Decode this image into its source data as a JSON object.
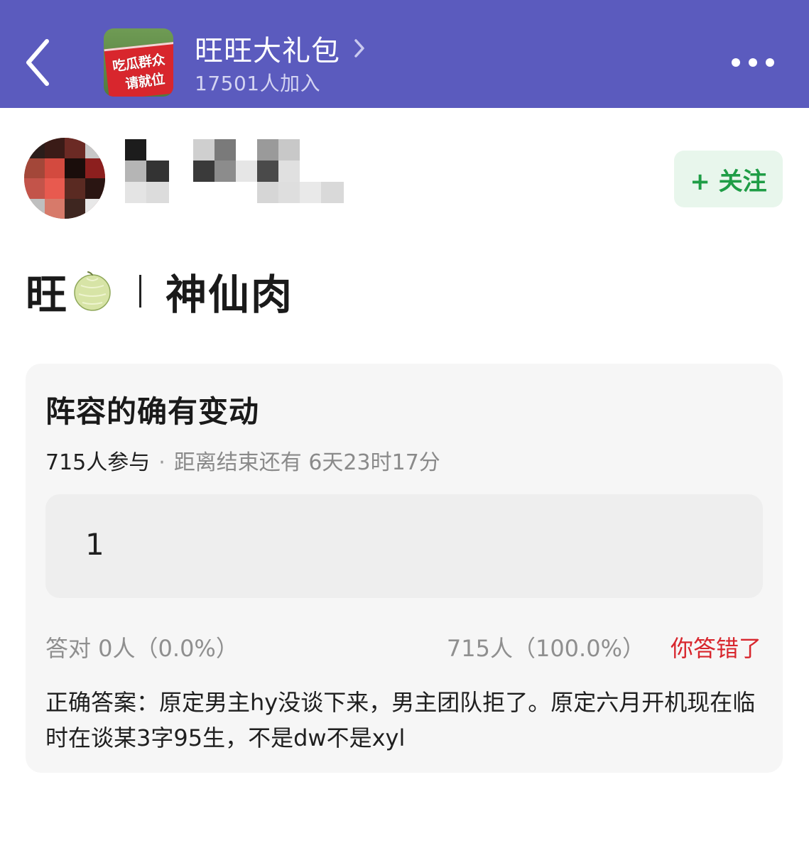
{
  "header": {
    "group_name": "旺旺大礼包",
    "member_count": "17501人加入",
    "avatar_sign_line1": "吃瓜群众",
    "avatar_sign_line2": "请就位",
    "bg_color": "#5b5bbe"
  },
  "author": {
    "avatar_icon": "pixelated-avatar",
    "name_icon": "pixelated-username",
    "follow_label": "+ 关注"
  },
  "post": {
    "title_prefix": "旺",
    "title_emoji": "melon-icon",
    "title_main": "神仙肉"
  },
  "quiz": {
    "question": "阵容的确有变动",
    "participants": "715人参与",
    "separator": "·",
    "deadline": "距离结束还有 6天23时17分",
    "option": "1",
    "correct_result": "答对  0人（0.0%）",
    "wrong_result": "715人（100.0%）",
    "user_status": "你答错了",
    "answer": "正确答案：原定男主hy没谈下来，男主团队拒了。原定六月开机现在临时在谈某3字95生，不是dw不是xyl"
  },
  "colors": {
    "accent_red": "#d8262d",
    "follow_green": "#1f9d46"
  }
}
